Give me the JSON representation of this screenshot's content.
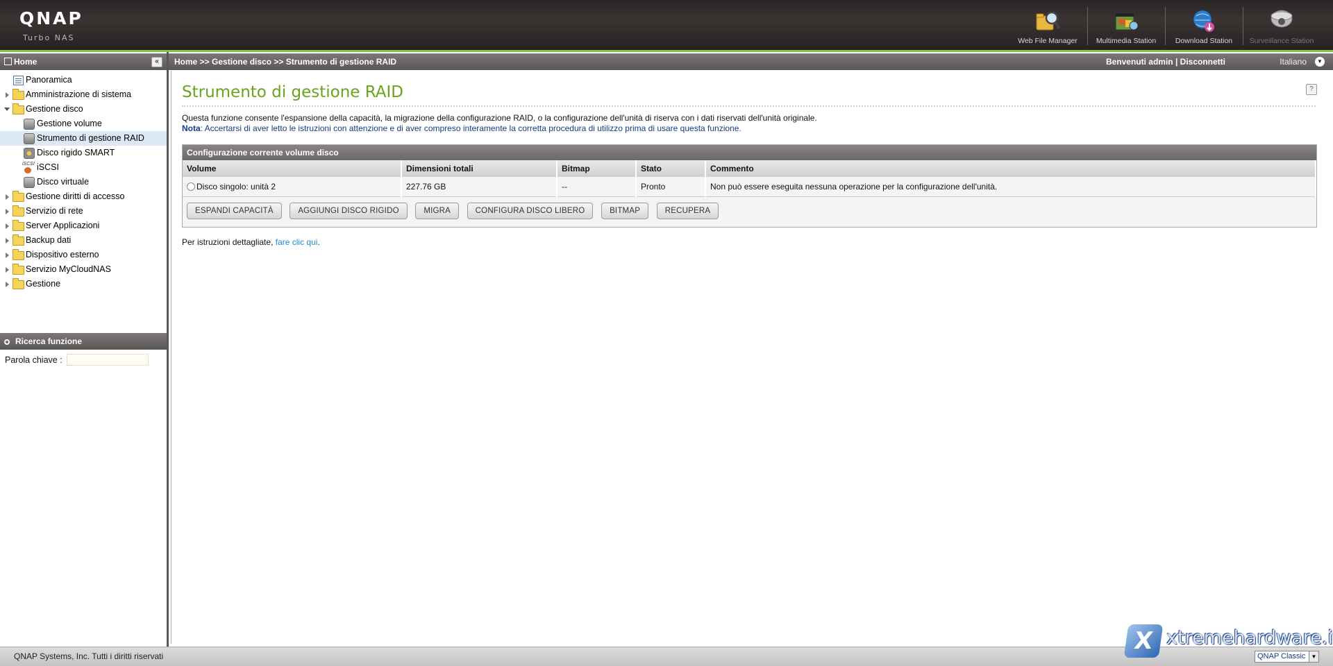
{
  "header": {
    "logo": "QNAP",
    "logo_sub": "Turbo NAS",
    "apps": [
      {
        "label": "Web File Manager",
        "icon": "file-manager-icon"
      },
      {
        "label": "Multimedia Station",
        "icon": "multimedia-icon"
      },
      {
        "label": "Download Station",
        "icon": "download-icon"
      },
      {
        "label": "Surveillance Station",
        "icon": "camera-icon"
      }
    ]
  },
  "sidebar": {
    "home_label": "Home",
    "items": [
      {
        "label": "Panoramica"
      },
      {
        "label": "Amministrazione di sistema"
      },
      {
        "label": "Gestione disco"
      },
      {
        "label": "Gestione volume"
      },
      {
        "label": "Strumento di gestione RAID"
      },
      {
        "label": "Disco rigido SMART"
      },
      {
        "label": "iSCSI"
      },
      {
        "label": "Disco virtuale"
      },
      {
        "label": "Gestione diritti di accesso"
      },
      {
        "label": "Servizio di rete"
      },
      {
        "label": "Server Applicazioni"
      },
      {
        "label": "Backup dati"
      },
      {
        "label": "Dispositivo esterno"
      },
      {
        "label": "Servizio MyCloudNAS"
      },
      {
        "label": "Gestione"
      }
    ],
    "search_title": "Ricerca funzione",
    "keyword_label": "Parola chiave :",
    "keyword_value": ""
  },
  "topbar": {
    "breadcrumb": "Home >> Gestione disco >> Strumento di gestione RAID",
    "welcome": "Benvenuti admin | Disconnetti",
    "language": "Italiano"
  },
  "main": {
    "title": "Strumento di gestione RAID",
    "description": "Questa funzione consente l'espansione della capacità, la migrazione della configurazione RAID, o la configurazione dell'unità di riserva con i dati riservati dell'unità originale.",
    "note_label": "Nota",
    "note_text": ": Accertarsi di aver letto le istruzioni con attenzione e di aver compreso interamente la corretta procedura di utilizzo prima di usare questa funzione.",
    "table": {
      "title": "Configurazione corrente volume disco",
      "headers": [
        "Volume",
        "Dimensioni totali",
        "Bitmap",
        "Stato",
        "Commento"
      ],
      "rows": [
        [
          "Disco singolo: unità 2",
          "227.76 GB",
          "--",
          "Pronto",
          "Non può essere eseguita nessuna operazione per la configurazione dell'unità."
        ]
      ]
    },
    "buttons": {
      "expand": "ESPANDI CAPACITÀ",
      "add_disk": "AGGIUNGI DISCO RIGIDO",
      "migrate": "MIGRA",
      "spare": "CONFIGURA DISCO LIBERO",
      "bitmap": "BITMAP",
      "recover": "RECUPERA"
    },
    "instructions_prefix": "Per istruzioni dettagliate, ",
    "instructions_link": "fare clic qui",
    "instructions_suffix": "."
  },
  "footer": {
    "copyright": "QNAP Systems, Inc. Tutti i diritti riservati",
    "theme": "QNAP Classic"
  },
  "watermark": {
    "mark": "X",
    "text": "xtremehardware.it"
  },
  "colors": {
    "accent_green": "#6aa31c",
    "link_blue": "#1a8fd0",
    "note_blue": "#123a84",
    "bar_gray": "#5a5656"
  }
}
